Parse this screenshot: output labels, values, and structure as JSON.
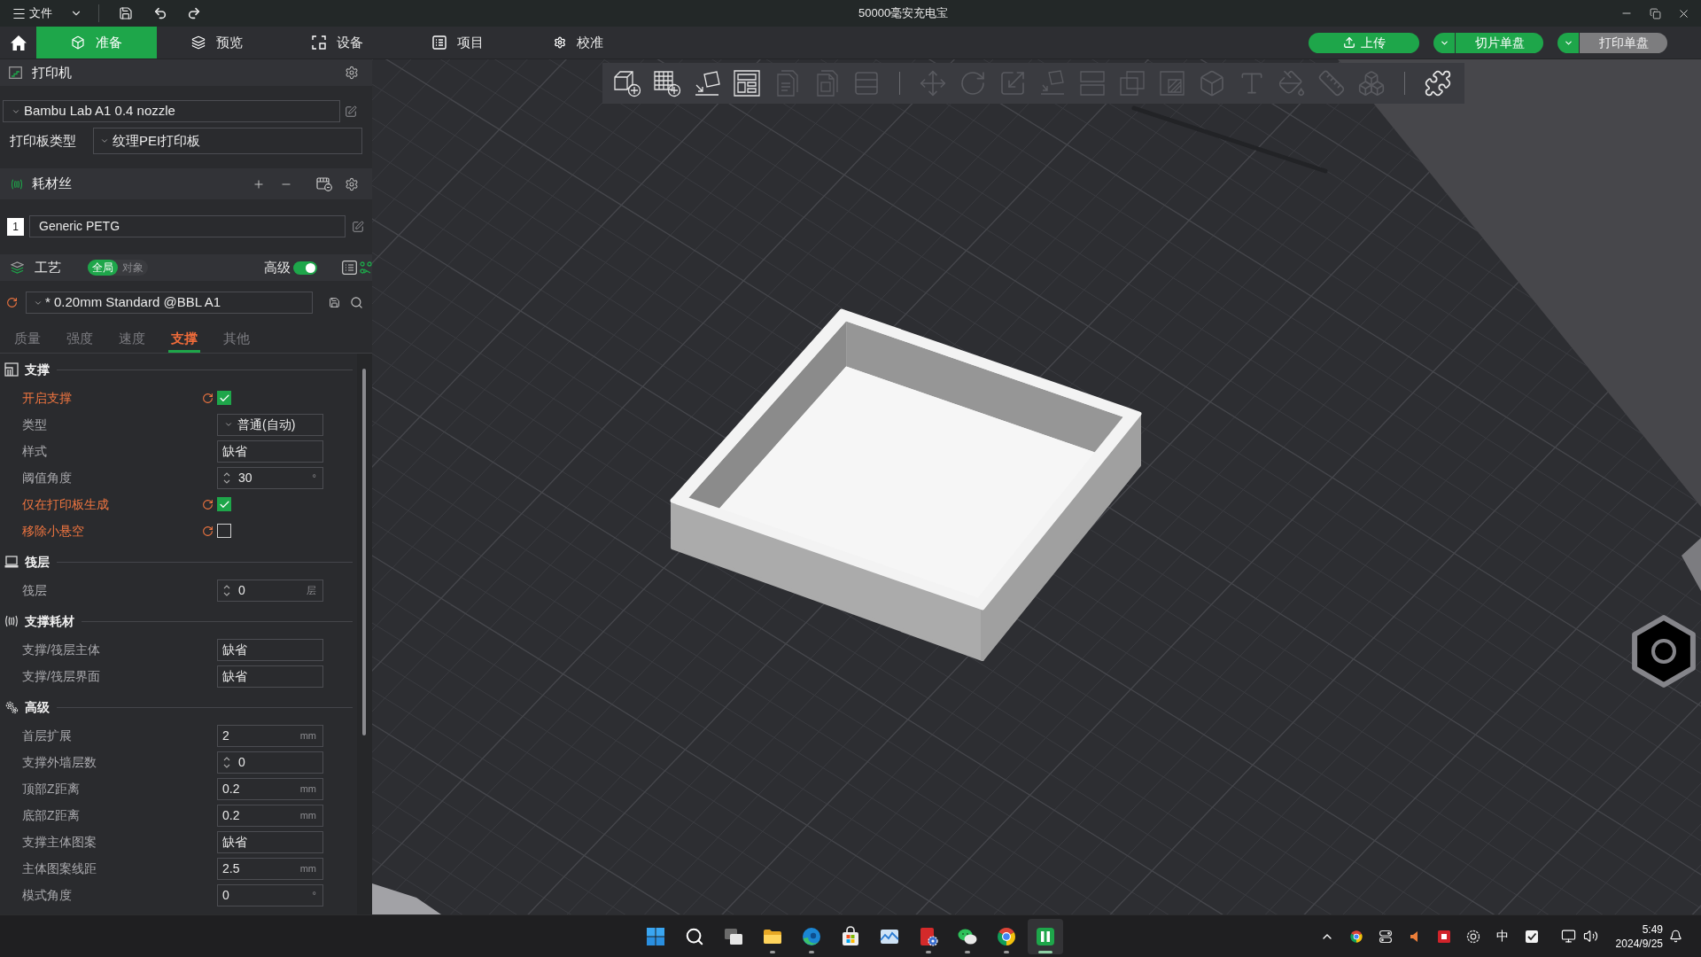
{
  "window": {
    "menu": "文件",
    "title": "50000毫安充电宝"
  },
  "tabs": [
    {
      "label": "准备",
      "selected": true
    },
    {
      "label": "预览",
      "selected": false
    },
    {
      "label": "设备",
      "selected": false
    },
    {
      "label": "项目",
      "selected": false
    },
    {
      "label": "校准",
      "selected": false
    }
  ],
  "actions": [
    {
      "kind": "single",
      "label": "上传",
      "disabled": false
    },
    {
      "kind": "split",
      "label": "切片单盘",
      "disabled": false
    },
    {
      "kind": "split",
      "label": "打印单盘",
      "disabled": true
    }
  ],
  "printer": {
    "title": "打印机",
    "preset": "Bambu Lab A1 0.4 nozzle",
    "plate_label": "打印板类型",
    "plate": "纹理PEI打印板"
  },
  "filament": {
    "title": "耗材丝",
    "slots": [
      {
        "number": "1",
        "color": "#ffffff",
        "name": "Generic PETG"
      }
    ]
  },
  "process": {
    "title": "工艺",
    "scope": [
      {
        "label": "全局",
        "selected": true
      },
      {
        "label": "对象",
        "selected": false
      }
    ],
    "advanced_label": "高级",
    "advanced": true,
    "preset": "* 0.20mm Standard @BBL A1",
    "modified": true,
    "tabs": [
      {
        "label": "质量",
        "selected": false,
        "modified": false
      },
      {
        "label": "强度",
        "selected": false,
        "modified": false
      },
      {
        "label": "速度",
        "selected": false,
        "modified": false
      },
      {
        "label": "支撑",
        "selected": true,
        "modified": true
      },
      {
        "label": "其他",
        "selected": false,
        "modified": false
      }
    ]
  },
  "sections": [
    {
      "title": "支撑",
      "rows": [
        {
          "label": "开启支撑",
          "kind": "checkbox",
          "modified": true,
          "checked": true
        },
        {
          "label": "类型",
          "kind": "select",
          "modified": false,
          "value": "普通(自动)"
        },
        {
          "label": "样式",
          "kind": "text",
          "modified": false,
          "value": "缺省"
        },
        {
          "label": "阈值角度",
          "kind": "spin",
          "modified": false,
          "value": "30",
          "unit": "°"
        },
        {
          "label": "仅在打印板生成",
          "kind": "checkbox",
          "modified": true,
          "checked": true
        },
        {
          "label": "移除小悬空",
          "kind": "checkbox",
          "modified": true,
          "checked": false
        }
      ]
    },
    {
      "title": "筏层",
      "rows": [
        {
          "label": "筏层",
          "kind": "spin",
          "modified": false,
          "value": "0",
          "unit": "层"
        }
      ]
    },
    {
      "title": "支撑耗材",
      "rows": [
        {
          "label": "支撑/筏层主体",
          "kind": "text",
          "modified": false,
          "value": "缺省"
        },
        {
          "label": "支撑/筏层界面",
          "kind": "text",
          "modified": false,
          "value": "缺省"
        }
      ]
    },
    {
      "title": "高级",
      "rows": [
        {
          "label": "首层扩展",
          "kind": "text",
          "modified": false,
          "value": "2",
          "unit": "mm"
        },
        {
          "label": "支撑外墙层数",
          "kind": "spin",
          "modified": false,
          "value": "0"
        },
        {
          "label": "顶部Z距离",
          "kind": "text",
          "modified": false,
          "value": "0.2",
          "unit": "mm"
        },
        {
          "label": "底部Z距离",
          "kind": "text",
          "modified": false,
          "value": "0.2",
          "unit": "mm"
        },
        {
          "label": "支撑主体图案",
          "kind": "text",
          "modified": false,
          "value": "缺省"
        },
        {
          "label": "主体图案线距",
          "kind": "text",
          "modified": false,
          "value": "2.5",
          "unit": "mm"
        },
        {
          "label": "模式角度",
          "kind": "text",
          "modified": false,
          "value": "0",
          "unit": "°"
        }
      ]
    }
  ],
  "toolbar": {
    "groups": [
      {
        "items": [
          {
            "kind": "add-object",
            "disabled": false
          },
          {
            "kind": "add-plate",
            "disabled": false
          },
          {
            "kind": "orient",
            "disabled": false
          },
          {
            "kind": "arrange",
            "disabled": false
          },
          {
            "kind": "document",
            "disabled": true
          },
          {
            "kind": "documents",
            "disabled": true
          },
          {
            "kind": "lines",
            "disabled": true
          }
        ]
      },
      {
        "items": [
          {
            "kind": "move",
            "disabled": true
          },
          {
            "kind": "rotate",
            "disabled": true
          },
          {
            "kind": "scale",
            "disabled": true
          },
          {
            "kind": "flatten",
            "disabled": true
          },
          {
            "kind": "cut",
            "disabled": true
          },
          {
            "kind": "boolean",
            "disabled": true
          },
          {
            "kind": "support",
            "disabled": true
          },
          {
            "kind": "seam",
            "disabled": true
          },
          {
            "kind": "text",
            "disabled": true
          },
          {
            "kind": "paint",
            "disabled": true
          },
          {
            "kind": "measure",
            "disabled": true
          },
          {
            "kind": "assembly",
            "disabled": true
          }
        ]
      },
      {
        "items": [
          {
            "kind": "puzzle",
            "disabled": false
          }
        ]
      }
    ]
  },
  "taskbar": {
    "apps": [
      {
        "kind": "start",
        "running": false,
        "selected": false
      },
      {
        "kind": "search",
        "running": false,
        "selected": false
      },
      {
        "kind": "taskview",
        "running": false,
        "selected": false
      },
      {
        "kind": "folder",
        "running": true,
        "selected": false
      },
      {
        "kind": "edge",
        "running": true,
        "selected": false
      },
      {
        "kind": "store",
        "running": false,
        "selected": false
      },
      {
        "kind": "gallery",
        "running": false,
        "selected": false
      },
      {
        "kind": "cad",
        "running": true,
        "selected": false
      },
      {
        "kind": "chat",
        "running": true,
        "selected": false
      },
      {
        "kind": "chrome",
        "running": true,
        "selected": false
      },
      {
        "kind": "slicer",
        "running": true,
        "selected": true
      }
    ],
    "tray": [
      {
        "kind": "chevron"
      },
      {
        "kind": "chrome"
      },
      {
        "kind": "switch"
      },
      {
        "kind": "speaker"
      },
      {
        "kind": "app"
      },
      {
        "kind": "badge"
      },
      {
        "kind": "ime",
        "label": "中"
      },
      {
        "kind": "check"
      },
      {
        "kind": "network"
      },
      {
        "kind": "volume"
      }
    ],
    "time": "5:49",
    "date": "2024/9/25"
  }
}
